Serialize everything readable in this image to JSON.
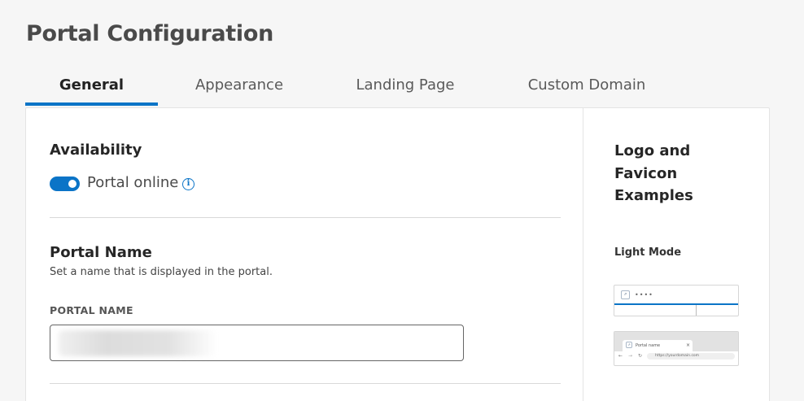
{
  "page": {
    "title": "Portal Configuration"
  },
  "tabs": [
    {
      "label": "General",
      "active": true
    },
    {
      "label": "Appearance",
      "active": false
    },
    {
      "label": "Landing Page",
      "active": false
    },
    {
      "label": "Custom Domain",
      "active": false
    }
  ],
  "availability": {
    "heading": "Availability",
    "toggle_label": "Portal online",
    "toggle_on": true,
    "info_icon": "info-icon"
  },
  "portal_name": {
    "heading": "Portal Name",
    "description": "Set a name that is displayed in the portal.",
    "field_label": "PORTAL NAME",
    "value": ""
  },
  "sidebar": {
    "heading": "Logo and Favicon Examples",
    "mode_label": "Light Mode",
    "example_dots": "••••",
    "favicon_tab_label": "Portal name",
    "favicon_url": "https://yourdomain.com"
  },
  "colors": {
    "accent": "#0b74c7",
    "background": "#f6f6f6",
    "card": "#ffffff"
  }
}
